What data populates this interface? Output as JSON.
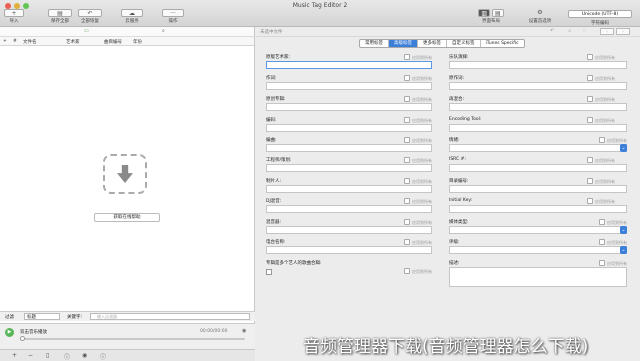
{
  "window": {
    "title": "Music Tag Editor 2"
  },
  "toolbar": {
    "import": "导入",
    "save_all": "保存全部",
    "undo_all": "全部恢复",
    "cloud_match": "云服务",
    "operate": "操作",
    "layout": "界面布局",
    "prefs": "设置首选项",
    "encoding_label": "字符编码",
    "encoding_value": "Unicode (UTF-8)"
  },
  "list": {
    "columns": [
      "#",
      "文件名",
      "艺术家",
      "曲目编号",
      "年份"
    ],
    "help_button": "获取在线帮助"
  },
  "filter": {
    "label": "过滤",
    "field_value": "标题",
    "keyword_label": "关键字:",
    "keyword_placeholder": "输入过滤器"
  },
  "player": {
    "title": "双击音乐播放",
    "time": "00:00/00:00"
  },
  "editor": {
    "no_file": "未选中文件",
    "tabs": [
      "常用标签",
      "高级标签",
      "更多标签",
      "自定义标签",
      "iTunes Specific"
    ],
    "active_tab": 1,
    "apply_label": "应用到所有",
    "fields_left": [
      "原版艺术家:",
      "作词:",
      "原创专辑:",
      "编码:",
      "编曲:",
      "工程师/策划:",
      "制片人:",
      "DJ混音:",
      "混音器:",
      "电台名称:",
      "专辑是多个艺人的歌曲合辑:"
    ],
    "fields_right": [
      "乐队演绎:",
      "原作词:",
      "再混合:",
      "Encoding Tool:",
      "情绪:",
      "ISRC #:",
      "目录编号:",
      "Initial Key:",
      "媒体类型:",
      "评级:",
      "描述:"
    ]
  },
  "watermark": "音频管理器下载(音频管理器怎么下载)"
}
